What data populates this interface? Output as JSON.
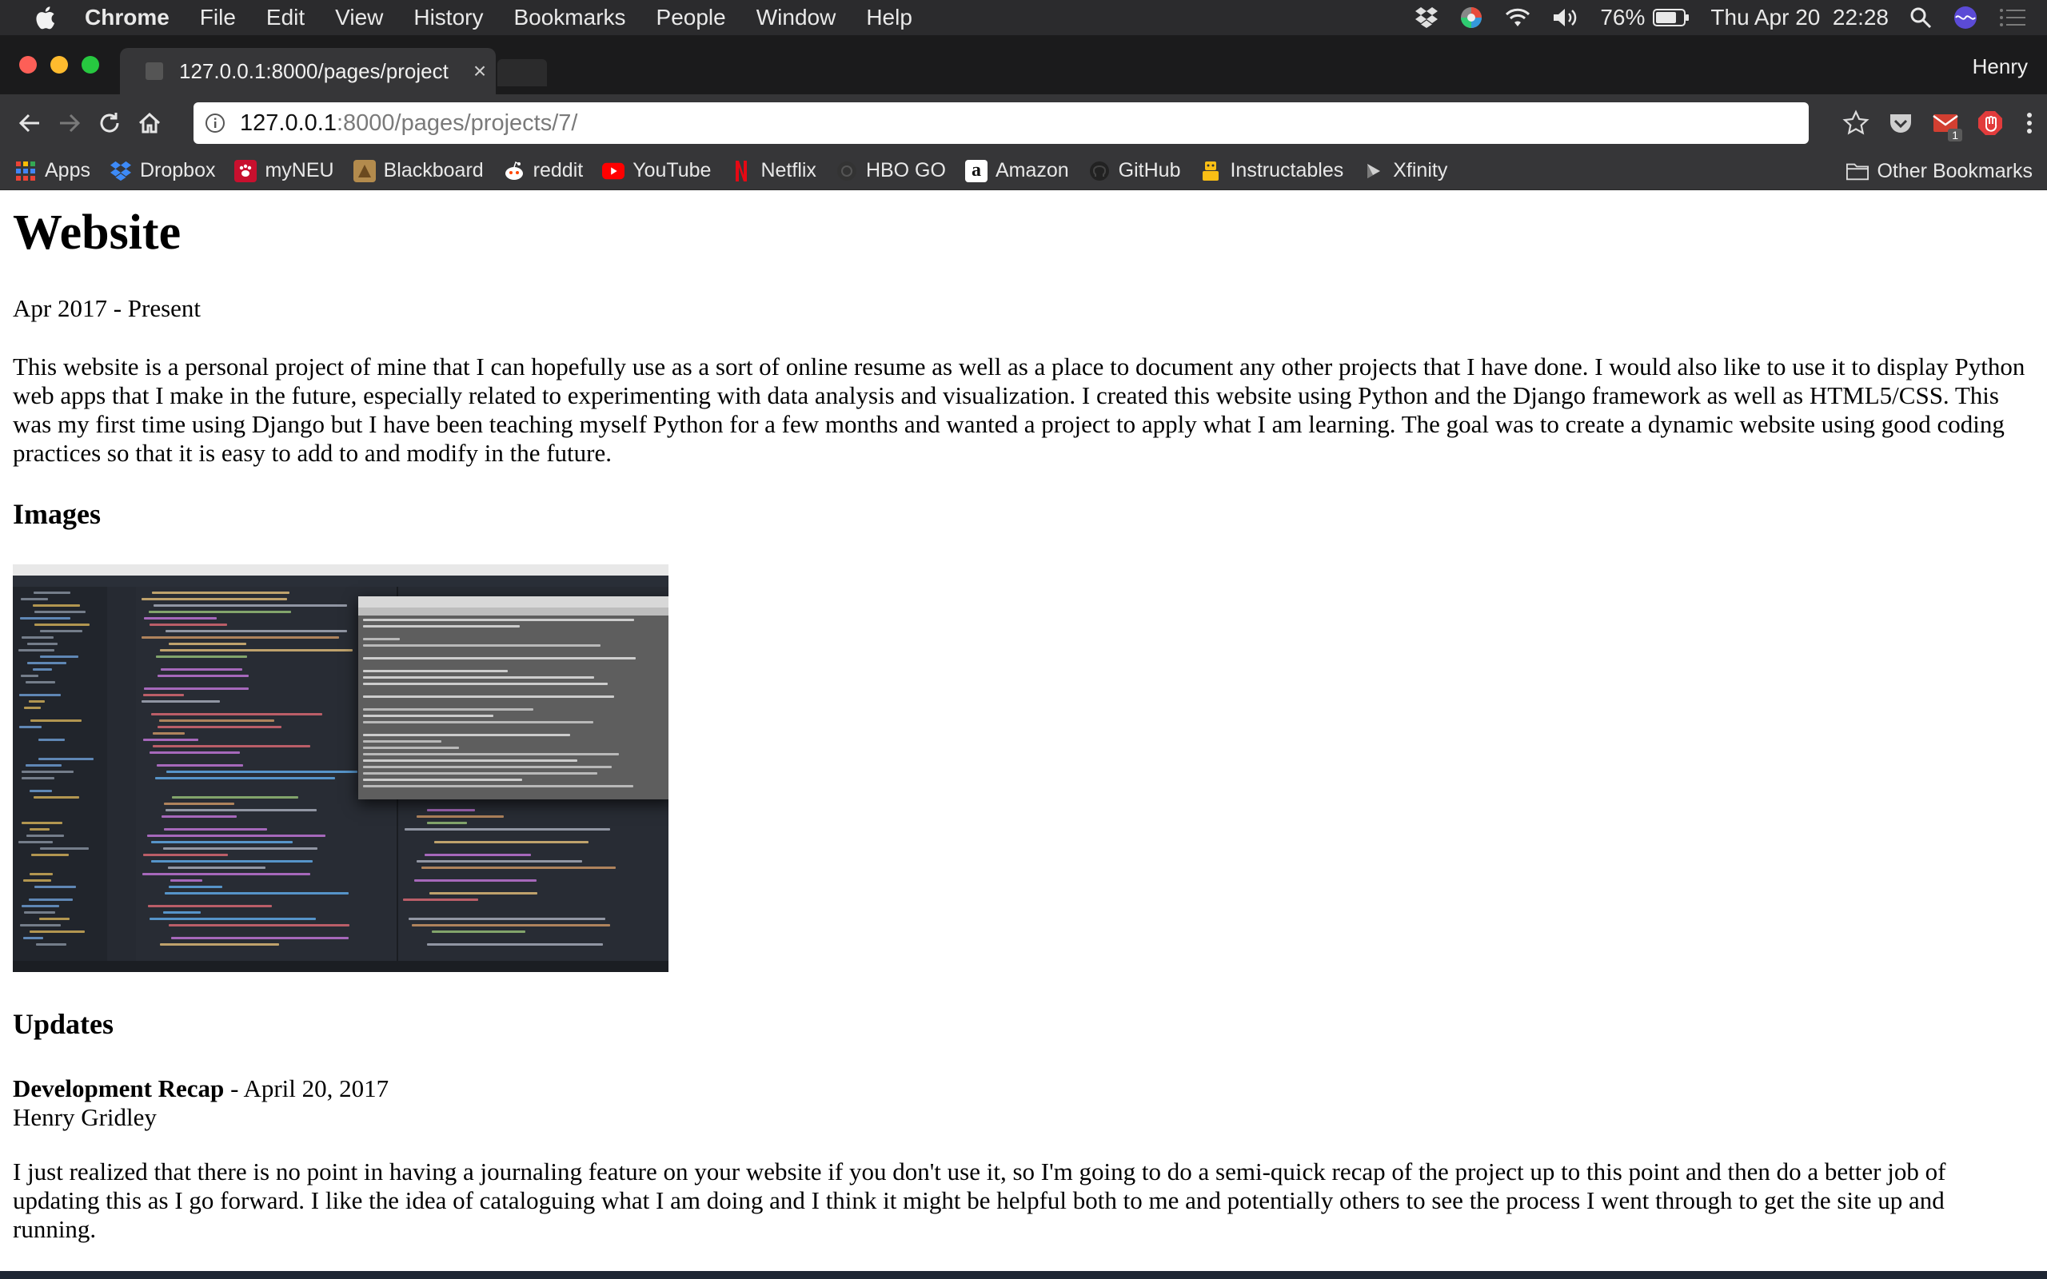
{
  "menubar": {
    "app_name": "Chrome",
    "items": [
      "File",
      "Edit",
      "View",
      "History",
      "Bookmarks",
      "People",
      "Window",
      "Help"
    ],
    "battery": "76%",
    "datetime": "Thu Apr 20  22:28"
  },
  "tab": {
    "title": "127.0.0.1:8000/pages/project",
    "close": "×"
  },
  "profile_name": "Henry",
  "omnibox": {
    "host": "127.0.0.1",
    "path": ":8000/pages/projects/7/"
  },
  "extensions": {
    "badge_count": "1"
  },
  "bookmarks": {
    "items": [
      {
        "label": "Apps",
        "icon": "apps-grid-icon",
        "color": "#888888"
      },
      {
        "label": "Dropbox",
        "icon": "dropbox-icon",
        "color": "#0061ff"
      },
      {
        "label": "myNEU",
        "icon": "husky-paw-icon",
        "color": "#c8102e"
      },
      {
        "label": "Blackboard",
        "icon": "blackboard-icon",
        "color": "#b38b4d"
      },
      {
        "label": "reddit",
        "icon": "reddit-icon",
        "color": "#ff4500"
      },
      {
        "label": "YouTube",
        "icon": "youtube-icon",
        "color": "#ff0000"
      },
      {
        "label": "Netflix",
        "icon": "netflix-icon",
        "color": "#e50914"
      },
      {
        "label": "HBO GO",
        "icon": "hbo-icon",
        "color": "#333333"
      },
      {
        "label": "Amazon",
        "icon": "amazon-icon",
        "color": "#ffffff"
      },
      {
        "label": "GitHub",
        "icon": "github-icon",
        "color": "#222222"
      },
      {
        "label": "Instructables",
        "icon": "instructables-robot-icon",
        "color": "#fabf15"
      },
      {
        "label": "Xfinity",
        "icon": "xfinity-icon",
        "color": "#555555"
      }
    ],
    "other": "Other Bookmarks"
  },
  "page": {
    "title": "Website",
    "date_range": "Apr 2017 - Present",
    "intro": "This website is a personal project of mine that I can hopefully use as a sort of online resume as well as a place to document any other projects that I have done. I would also like to use it to display Python web apps that I make in the future, especially related to experimenting with data analysis and visualization. I created this website using Python and the Django framework as well as HTML5/CSS. This was my first time using Django but I have been teaching myself Python for a few months and wanted a project to apply what I am learning. The goal was to create a dynamic website using good coding practices so that it is easy to add to and modify in the future.",
    "images_heading": "Images",
    "updates_heading": "Updates",
    "update": {
      "title": "Development Recap",
      "separator": " - ",
      "date": "April 20, 2017",
      "author": "Henry Gridley",
      "text": "I just realized that there is no point in having a journaling feature on your website if you don't use it, so I'm going to do a semi-quick recap of the project up to this point and then do a better job of updating this as I go forward. I like the idea of cataloguing what I am doing and I think it might be helpful both to me and potentially others to see the process I went through to get the site up and running."
    }
  }
}
